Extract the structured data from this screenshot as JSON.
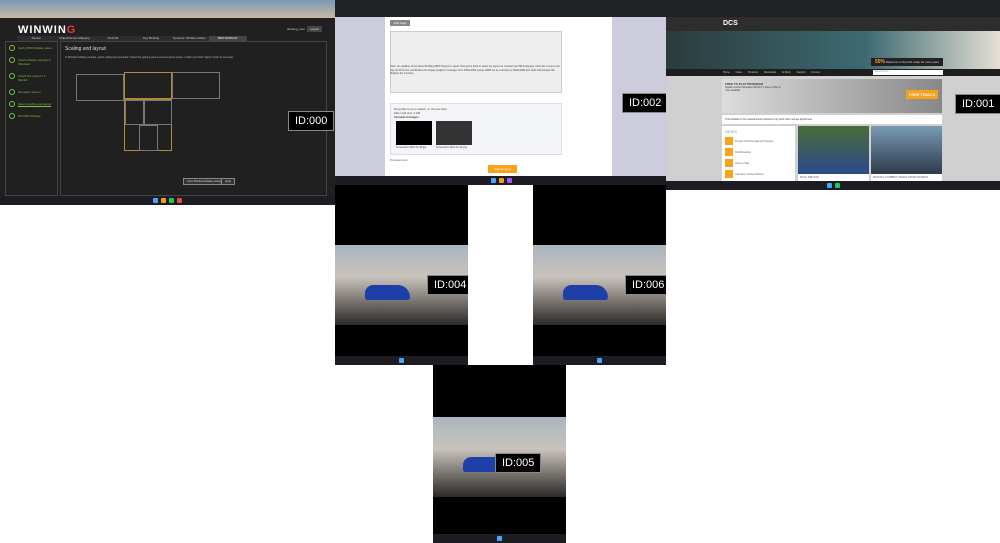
{
  "screens": {
    "s000": {
      "id_label": "ID:000",
      "app": {
        "logo_main": "WINWIN",
        "logo_accent": "G",
        "user": "winwing_user",
        "logout": "Logout",
        "tabs": [
          "Device",
          "Virtual Device Mapping",
          "AGS-04",
          "Key Binding",
          "Dynamic Vibration Motor",
          "MFD DISPLAY"
        ],
        "steps": [
          "Verify MFD Display status",
          "Check display settings in Windows",
          "Check the setup in 3 Monitor",
          "Set game screen",
          "Select scaling and layout",
          "Set MFD Display"
        ],
        "heading": "Scaling and layout",
        "description": "In Windows Display settings, select scaling and resolution. Select the gaming area to present game screen, confirm and click \"Apply\" button to next step.",
        "open_settings": "Open Windows Display settings",
        "apply": "Apply"
      }
    },
    "s002": {
      "id_label": "ID:002",
      "forum": {
        "edit_tags": "Edit Tags",
        "attach_title": "Drag files here to attach, or choose files",
        "attach_info": "Max total size 2 GB",
        "uploaded": "Uploaded Images",
        "file1": "Screenshot 2023-12-08.jpg",
        "file2": "Screenshot 2023-12-10.png",
        "preview": "Preview topic",
        "submit": "Submit Topic",
        "body": "Hello, the addition of the latest WinWing MFD Support is great. Having the tools to select the layout for monitors and MFD displays. Note this is due to the way the DCS ties coordinates the display weights it manages from 3840x1080 (using 1080P as an example) to 5920x1080 and while that window fills displays the monitors."
      }
    },
    "s001": {
      "id_label": "ID:001",
      "dcs": {
        "logo": "DCS",
        "promo_pct": "50%",
        "promo_text": "Discount on the first order for new users",
        "nav": [
          "Home",
          "News",
          "Products",
          "Downloads",
          "E-Shop",
          "Support",
          "Forums"
        ],
        "search_placeholder": "Search here",
        "f2p_title": "FREE TO PLAY PROGRAM",
        "f2p_text": "Digital Combat Simulator World 2.7 Free to Play is now available.",
        "free_trials": "FREE TRIALS",
        "eula": "This software is for entertainment purposes only. End User License Agreement",
        "news_title": "NEWS",
        "news": [
          "Persian Gulf Reimagined Progress",
          "Multithreading",
          "Autumn Sale",
          "Operation Jubilee Mission"
        ],
        "card1": "DCS: MB-339",
        "card2": "DIGITAL COMBAT SIMULATOR WORLD"
      }
    },
    "s004": {
      "id_label": "ID:004"
    },
    "s006": {
      "id_label": "ID:006"
    },
    "s005": {
      "id_label": "ID:005"
    }
  },
  "taskbar_colors": [
    "#4aa3ff",
    "#3b82f6",
    "#f59e0b",
    "#a855f7",
    "#22c55e",
    "#ef4444",
    "#e5e7eb",
    "#60a5fa"
  ]
}
